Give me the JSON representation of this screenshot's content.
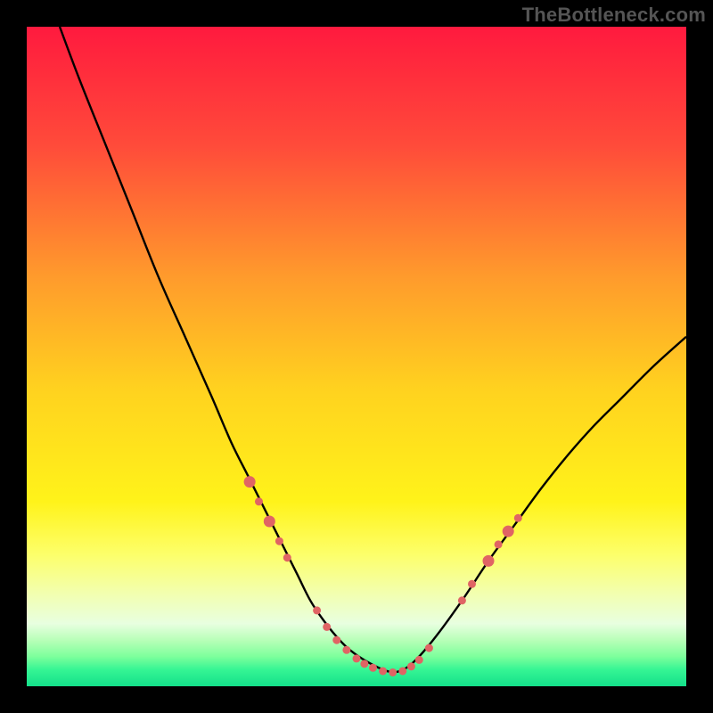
{
  "attribution": "TheBottleneck.com",
  "chart_data": {
    "type": "line",
    "title": "",
    "xlabel": "",
    "ylabel": "",
    "xlim": [
      0,
      100
    ],
    "ylim": [
      0,
      100
    ],
    "gradient_stops": [
      {
        "offset": 0.0,
        "color": "#ff1a3e"
      },
      {
        "offset": 0.18,
        "color": "#ff4b3a"
      },
      {
        "offset": 0.38,
        "color": "#ff9b2c"
      },
      {
        "offset": 0.55,
        "color": "#ffd21f"
      },
      {
        "offset": 0.72,
        "color": "#fff31a"
      },
      {
        "offset": 0.8,
        "color": "#fdff6a"
      },
      {
        "offset": 0.86,
        "color": "#f2ffb0"
      },
      {
        "offset": 0.905,
        "color": "#e8ffe0"
      },
      {
        "offset": 0.93,
        "color": "#b8ffb8"
      },
      {
        "offset": 0.955,
        "color": "#7dff9c"
      },
      {
        "offset": 0.975,
        "color": "#35f594"
      },
      {
        "offset": 1.0,
        "color": "#14e08a"
      }
    ],
    "series": [
      {
        "name": "bottleneck-curve",
        "x": [
          5,
          8,
          12,
          16,
          20,
          24,
          28,
          31,
          33.5,
          36,
          38.5,
          41,
          43,
          45,
          47,
          49,
          52,
          55,
          57,
          59,
          62,
          66,
          70,
          74,
          78,
          82,
          86,
          90,
          95,
          100
        ],
        "y": [
          100,
          92,
          82,
          72,
          62,
          53,
          44,
          37,
          32,
          27,
          22,
          17,
          13,
          10,
          7.5,
          5.5,
          3.5,
          2.2,
          2.5,
          4,
          7.5,
          13,
          19,
          24.5,
          30,
          35,
          39.5,
          43.5,
          48.5,
          53
        ]
      }
    ],
    "markers": {
      "name": "highlighted-points",
      "color": "#e06464",
      "radius_small": 4.5,
      "radius_large": 6.5,
      "points": [
        {
          "x": 33.8,
          "y": 31,
          "r": "large"
        },
        {
          "x": 35.2,
          "y": 28,
          "r": "small"
        },
        {
          "x": 36.8,
          "y": 25,
          "r": "large"
        },
        {
          "x": 38.3,
          "y": 22,
          "r": "small"
        },
        {
          "x": 39.5,
          "y": 19.5,
          "r": "small"
        },
        {
          "x": 44.0,
          "y": 11.5,
          "r": "small"
        },
        {
          "x": 45.5,
          "y": 9.0,
          "r": "small"
        },
        {
          "x": 47.0,
          "y": 7.0,
          "r": "small"
        },
        {
          "x": 48.5,
          "y": 5.5,
          "r": "small"
        },
        {
          "x": 50.0,
          "y": 4.2,
          "r": "small"
        },
        {
          "x": 51.2,
          "y": 3.4,
          "r": "small"
        },
        {
          "x": 52.5,
          "y": 2.8,
          "r": "small"
        },
        {
          "x": 54.0,
          "y": 2.3,
          "r": "small"
        },
        {
          "x": 55.5,
          "y": 2.1,
          "r": "small"
        },
        {
          "x": 57.0,
          "y": 2.3,
          "r": "small"
        },
        {
          "x": 58.3,
          "y": 3.0,
          "r": "small"
        },
        {
          "x": 59.5,
          "y": 4.0,
          "r": "small"
        },
        {
          "x": 61.0,
          "y": 5.8,
          "r": "small"
        },
        {
          "x": 66.0,
          "y": 13.0,
          "r": "small"
        },
        {
          "x": 67.5,
          "y": 15.5,
          "r": "small"
        },
        {
          "x": 70.0,
          "y": 19.0,
          "r": "large"
        },
        {
          "x": 71.5,
          "y": 21.5,
          "r": "small"
        },
        {
          "x": 73.0,
          "y": 23.5,
          "r": "large"
        },
        {
          "x": 74.5,
          "y": 25.5,
          "r": "small"
        }
      ]
    }
  }
}
